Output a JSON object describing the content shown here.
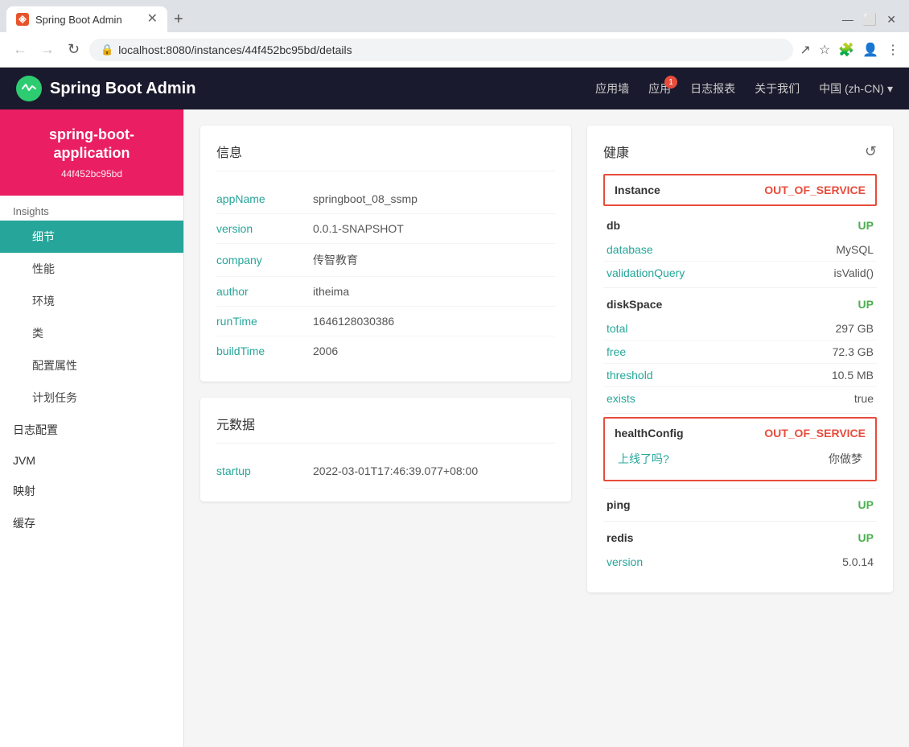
{
  "browser": {
    "tab_title": "Spring Boot Admin",
    "url": "localhost:8080/instances/44f452bc95bd/details",
    "new_tab_btn": "+",
    "nav_back": "←",
    "nav_forward": "→",
    "nav_refresh": "↻"
  },
  "app": {
    "title": "Spring Boot Admin",
    "nav": {
      "app_wall": "应用墙",
      "apps": "应用",
      "apps_badge": "1",
      "logs": "日志报表",
      "about": "关于我们",
      "language": "中国 (zh-CN)"
    }
  },
  "instance": {
    "name": "spring-boot-application",
    "id": "44f452bc95bd"
  },
  "sidebar": {
    "insights_label": "Insights",
    "items": [
      {
        "label": "细节",
        "active": true,
        "indent": true
      },
      {
        "label": "性能",
        "active": false,
        "indent": true
      },
      {
        "label": "环境",
        "active": false,
        "indent": true
      },
      {
        "label": "类",
        "active": false,
        "indent": true
      },
      {
        "label": "配置属性",
        "active": false,
        "indent": true
      },
      {
        "label": "计划任务",
        "active": false,
        "indent": true
      }
    ],
    "other_items": [
      {
        "label": "日志配置"
      },
      {
        "label": "JVM"
      },
      {
        "label": "映射"
      },
      {
        "label": "缓存"
      }
    ]
  },
  "info_card": {
    "title": "信息",
    "rows": [
      {
        "key": "appName",
        "value": "springboot_08_ssmp"
      },
      {
        "key": "version",
        "value": "0.0.1-SNAPSHOT"
      },
      {
        "key": "company",
        "value": "传智教育"
      },
      {
        "key": "author",
        "value": "itheima"
      },
      {
        "key": "runTime",
        "value": "1646128030386"
      },
      {
        "key": "buildTime",
        "value": "2006"
      }
    ]
  },
  "metadata_card": {
    "title": "元数据",
    "rows": [
      {
        "key": "startup",
        "value": "2022-03-01T17:46:39.077+08:00"
      }
    ]
  },
  "health_card": {
    "title": "健康",
    "instance_label": "Instance",
    "instance_status": "OUT_OF_SERVICE",
    "sections": [
      {
        "name": "db",
        "status": "UP",
        "details": [
          {
            "key": "database",
            "value": "MySQL"
          },
          {
            "key": "validationQuery",
            "value": "isValid()"
          }
        ]
      },
      {
        "name": "diskSpace",
        "status": "UP",
        "details": [
          {
            "key": "total",
            "value": "297 GB"
          },
          {
            "key": "free",
            "value": "72.3 GB"
          },
          {
            "key": "threshold",
            "value": "10.5 MB"
          },
          {
            "key": "exists",
            "value": "true"
          }
        ]
      },
      {
        "name": "healthConfig",
        "status": "OUT_OF_SERVICE",
        "out_of_service": true,
        "details": [
          {
            "key": "上线了吗?",
            "value": "你做梦"
          }
        ]
      },
      {
        "name": "ping",
        "status": "UP",
        "details": []
      },
      {
        "name": "redis",
        "status": "UP",
        "details": [
          {
            "key": "version",
            "value": "5.0.14"
          }
        ]
      }
    ]
  }
}
